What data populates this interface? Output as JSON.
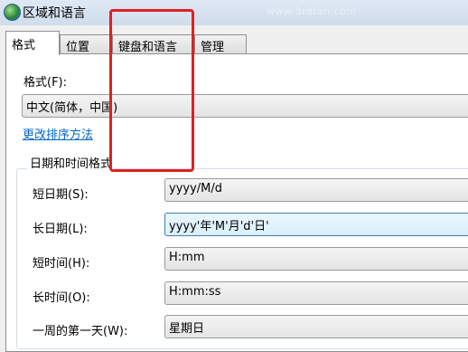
{
  "window": {
    "title": "区域和语言",
    "watermark": "www.3rdfan.com"
  },
  "tabs": [
    {
      "label": "格式",
      "active": true
    },
    {
      "label": "位置",
      "active": false
    },
    {
      "label": "键盘和语言",
      "active": false
    },
    {
      "label": "管理",
      "active": false
    }
  ],
  "format": {
    "label": "格式(F):",
    "value": "中文(简体，中国)",
    "sort_link": "更改排序方法"
  },
  "datetime": {
    "group_title": "日期和时间格式",
    "rows": [
      {
        "label": "短日期(S):",
        "value": "yyyy/M/d"
      },
      {
        "label": "长日期(L):",
        "value": "yyyy'年'M'月'd'日'"
      },
      {
        "label": "短时间(H):",
        "value": "H:mm"
      },
      {
        "label": "长时间(O):",
        "value": "H:mm:ss"
      },
      {
        "label": "一周的第一天(W):",
        "value": "星期日"
      }
    ]
  },
  "colors": {
    "highlight": "#e02020",
    "link": "#0066cc"
  }
}
